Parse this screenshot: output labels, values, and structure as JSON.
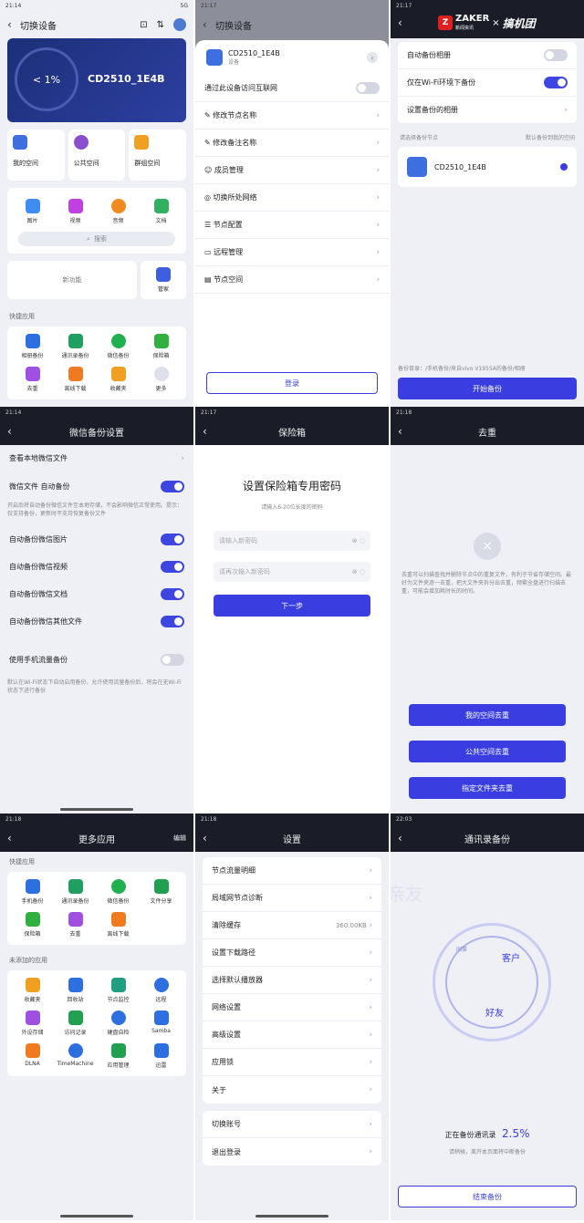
{
  "screens": {
    "s1": {
      "status": {
        "time": "21:14",
        "right": "5G"
      },
      "title": "切换设备",
      "device": {
        "name": "CD2510_1E4B",
        "percent_text": "< 1%",
        "percent_num": "1"
      },
      "spaces": [
        "我的空间",
        "公共空间",
        "群组空间"
      ],
      "media": [
        "图片",
        "视频",
        "音频",
        "文档"
      ],
      "search": "搜索",
      "promo": "新功能",
      "manage": "管家",
      "quick_title": "快捷应用",
      "quick_apps": [
        "相册备份",
        "通讯录备份",
        "微信备份",
        "保险箱"
      ],
      "quick_apps2": [
        "去重",
        "离线下载",
        "收藏夹",
        "更多"
      ],
      "colors": {
        "accent": "#3a3ee0",
        "card": "#1c2f78"
      }
    },
    "s2": {
      "status": {
        "time": "21:17"
      },
      "title": "切换设备",
      "device": {
        "name": "CD2510_1E4B",
        "sub": "设备"
      },
      "internet_label": "通过此设备访问互联网",
      "items": [
        "修改节点名称",
        "修改备注名称",
        "成员管理",
        "切换所处网络",
        "节点配置",
        "远程管理",
        "节点空间"
      ],
      "button": "登录"
    },
    "s3": {
      "status": {
        "time": "21:17"
      },
      "logo_zaker": "ZAKER",
      "logo_sub": "新闻资讯",
      "logo_gjt": "搞机团",
      "auto_backup": "自动备份相册",
      "wifi_only": "仅在Wi-Fi环境下备份",
      "choose_album": "设置备份的相册",
      "select_node": "请选择备份节点",
      "select_hint": "默认备份到我的空间",
      "node_name": "CD2510_1E4B",
      "footer": "备份目录：/手机备份/来自vivo V1955A的备份/相册",
      "start_btn": "开始备份"
    },
    "s4": {
      "status": {
        "time": "21:14"
      },
      "title": "微信备份设置",
      "view_local": "查看本地微信文件",
      "auto_wechat": "微信文件 自动备份",
      "desc": "开启后将自动备份微信文件至本地存储，不会影响微信正常使用。提示：仅支持备份，更新时不支持恢复备份文件",
      "items": [
        "自动备份微信图片",
        "自动备份微信视频",
        "自动备份微信文档",
        "自动备份微信其他文件"
      ],
      "mobile_data": "使用手机流量备份",
      "mobile_desc": "默认在Wi-Fi状态下自动启用备份，允许使用流量备份后，将会在无Wi-Fi状态下进行备份"
    },
    "s5": {
      "status": {
        "time": "21:17"
      },
      "title": "保险箱",
      "heading": "设置保险箱专用密码",
      "sub": "请输入6-20位长度的密码",
      "ph1": "请输入新密码",
      "ph2": "请再次输入新密码",
      "button": "下一步"
    },
    "s6": {
      "status": {
        "time": "21:18"
      },
      "title": "去重",
      "desc": "去重可以扫描查找并删除节点中的重复文件，有利于节省存储空间。最好为文件夹逐一去重，把大文件夹拆分出去重，频繁全盘进行扫描去重，可能会增加耗时长的时间。",
      "btn1": "我的空间去重",
      "btn2": "公共空间去重",
      "btn3": "指定文件夹去重"
    },
    "s7": {
      "status": {
        "time": "21:18"
      },
      "title": "更多应用",
      "edit": "编辑",
      "quick_title": "快捷应用",
      "quick_apps": [
        "手机备份",
        "通讯录备份",
        "微信备份",
        "文件分享",
        "保险箱",
        "去重",
        "离线下载"
      ],
      "unused_title": "未添加的应用",
      "unused_apps": [
        "收藏夹",
        "回收站",
        "节点监控",
        "远程",
        "外设存储",
        "访问记录",
        "硬盘自检",
        "Samba",
        "DLNA",
        "TimeMachine",
        "应用管理",
        "迅雷"
      ]
    },
    "s8": {
      "status": {
        "time": "21:18"
      },
      "title": "设置",
      "items": [
        "节点流量明细",
        "局域网节点诊断",
        "清除缓存",
        "设置下载路径",
        "选择默认播放器",
        "网络设置",
        "高级设置",
        "应用锁",
        "关于"
      ],
      "cache_size": "360.00KB",
      "items2": [
        "切换账号",
        "退出登录"
      ]
    },
    "s9": {
      "status": {
        "time": "22:03"
      },
      "title": "通讯录备份",
      "bg_word": "亲友",
      "orbit_words": [
        "客户",
        "好友",
        "同事"
      ],
      "progress_label": "正在备份通讯录",
      "progress": "2.5%",
      "hint": "请稍候，离开本页面将中断备份",
      "button": "结束备份"
    }
  }
}
